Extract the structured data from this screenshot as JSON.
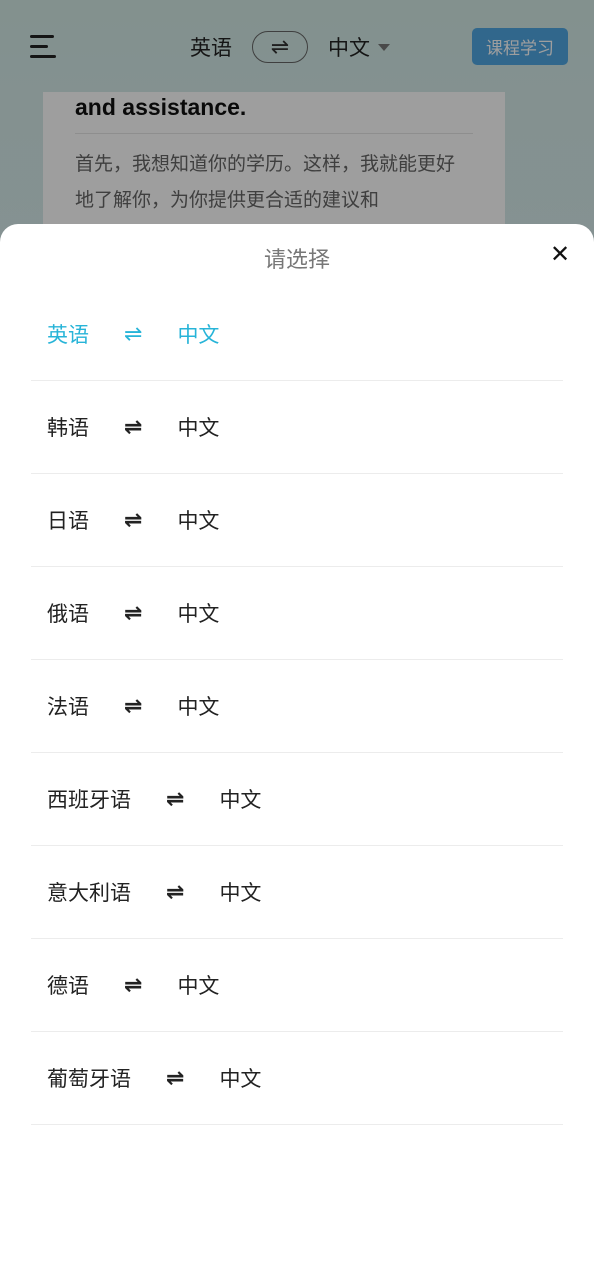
{
  "header": {
    "source_lang": "英语",
    "swap_symbol": "⇌",
    "target_lang": "中文",
    "course_button": "课程学习"
  },
  "background_card": {
    "english_text": "and assistance.",
    "chinese_text": "首先，我想知道你的学历。这样，我就能更好地了解你，为你提供更合适的建议和"
  },
  "sheet": {
    "title": "请选择",
    "close_symbol": "✕",
    "selected_color": "#27b4d8",
    "options": [
      {
        "src": "英语",
        "arrow": "⇌",
        "tgt": "中文",
        "selected": true
      },
      {
        "src": "韩语",
        "arrow": "⇌",
        "tgt": "中文"
      },
      {
        "src": "日语",
        "arrow": "⇌",
        "tgt": "中文"
      },
      {
        "src": "俄语",
        "arrow": "⇌",
        "tgt": "中文"
      },
      {
        "src": "法语",
        "arrow": "⇌",
        "tgt": "中文"
      },
      {
        "src": "西班牙语",
        "arrow": "⇌",
        "tgt": "中文"
      },
      {
        "src": "意大利语",
        "arrow": "⇌",
        "tgt": "中文"
      },
      {
        "src": "德语",
        "arrow": "⇌",
        "tgt": "中文"
      },
      {
        "src": "葡萄牙语",
        "arrow": "⇌",
        "tgt": "中文"
      }
    ]
  }
}
